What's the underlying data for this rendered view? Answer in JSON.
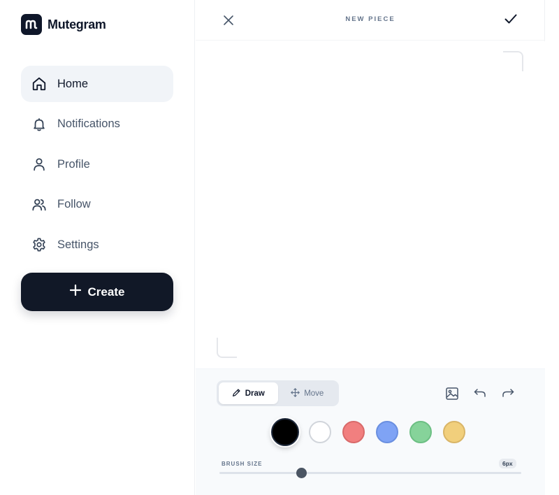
{
  "app": {
    "name": "Mutegram"
  },
  "sidebar": {
    "items": [
      {
        "label": "Home",
        "icon": "home-icon",
        "active": true
      },
      {
        "label": "Notifications",
        "icon": "bell-icon",
        "active": false
      },
      {
        "label": "Profile",
        "icon": "user-icon",
        "active": false
      },
      {
        "label": "Follow",
        "icon": "users-icon",
        "active": false
      },
      {
        "label": "Settings",
        "icon": "gear-icon",
        "active": false
      }
    ],
    "create_label": "Create"
  },
  "editor": {
    "title": "NEW PIECE",
    "modes": [
      {
        "label": "Draw",
        "icon": "pencil-icon",
        "active": true
      },
      {
        "label": "Move",
        "icon": "move-icon",
        "active": false
      }
    ],
    "tools": [
      "image-icon",
      "undo-icon",
      "redo-icon"
    ],
    "colors": [
      {
        "name": "black",
        "hex": "#000000",
        "selected": true
      },
      {
        "name": "white",
        "hex": "#ffffff",
        "selected": false
      },
      {
        "name": "red",
        "hex": "#f17f7f",
        "selected": false
      },
      {
        "name": "blue",
        "hex": "#7fa3f5",
        "selected": false
      },
      {
        "name": "green",
        "hex": "#86d39a",
        "selected": false
      },
      {
        "name": "yellow",
        "hex": "#f1cf7c",
        "selected": false
      }
    ],
    "brush": {
      "label": "BRUSH SIZE",
      "value_text": "6px",
      "level": 0.27
    }
  },
  "theme": {
    "primary": "#111827",
    "active_bg": "#f1f4f8",
    "muted_text": "#475569"
  }
}
